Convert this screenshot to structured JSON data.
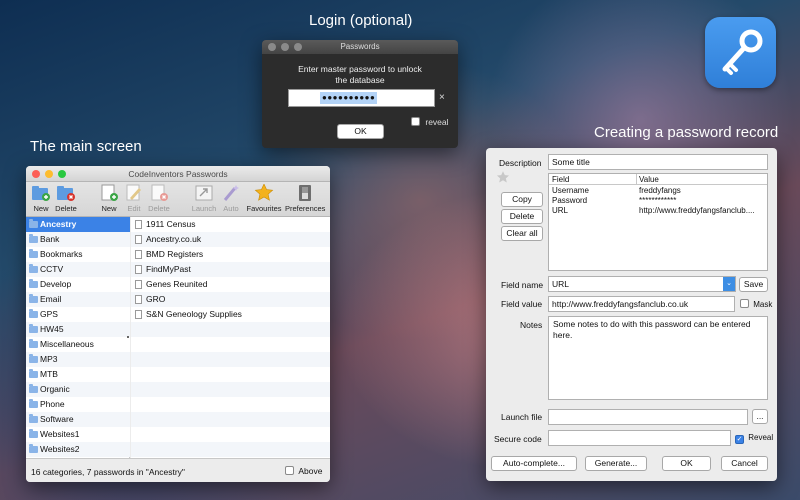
{
  "captions": {
    "login": "Login (optional)",
    "main": "The main screen",
    "record": "Creating a password record"
  },
  "login_dialog": {
    "title": "Passwords",
    "prompt_line1": "Enter master password to unlock",
    "prompt_line2": "the database",
    "password_value": "●●●●●●●●●●",
    "clear_glyph": "×",
    "reveal_label": "reveal",
    "ok_label": "OK"
  },
  "main_window": {
    "title": "CodeInventors Passwords",
    "toolbar": [
      {
        "label": "New",
        "icon": "folder-add-icon",
        "enabled": true
      },
      {
        "label": "Delete",
        "icon": "folder-delete-icon",
        "enabled": true
      },
      {
        "label": "New",
        "icon": "doc-add-icon",
        "enabled": true
      },
      {
        "label": "Edit",
        "icon": "doc-edit-icon",
        "enabled": false
      },
      {
        "label": "Delete",
        "icon": "doc-delete-icon",
        "enabled": false
      },
      {
        "label": "Launch",
        "icon": "launch-icon",
        "enabled": false
      },
      {
        "label": "Auto",
        "icon": "wand-icon",
        "enabled": false
      },
      {
        "label": "Favourites",
        "icon": "star-icon",
        "enabled": true
      },
      {
        "label": "Preferences",
        "icon": "switch-icon",
        "enabled": true
      }
    ],
    "categories": [
      "Ancestry",
      "Bank",
      "Bookmarks",
      "CCTV",
      "Develop",
      "Email",
      "GPS",
      "HW45",
      "Miscellaneous",
      "MP3",
      "MTB",
      "Organic",
      "Phone",
      "Software",
      "Websites1",
      "Websites2"
    ],
    "selected_category": "Ancestry",
    "passwords": [
      "1911 Census",
      "Ancestry.co.uk",
      "BMD Registers",
      "FindMyPast",
      "Genes Reunited",
      "GRO",
      "S&N Geneology Supplies"
    ],
    "status": "16 categories, 7 passwords in \"Ancestry\"",
    "above_label": "Above"
  },
  "record_window": {
    "description_label": "Description",
    "description_value": "Some title",
    "table_headers": [
      "Field",
      "Value"
    ],
    "table_rows": [
      [
        "Username",
        "freddyfangs"
      ],
      [
        "Password",
        "************"
      ],
      [
        "URL",
        "http://www.freddyfangsfanclub...."
      ]
    ],
    "copy_label": "Copy",
    "delete_label": "Delete",
    "clear_all_label": "Clear all",
    "field_name_label": "Field name",
    "field_name_value": "URL",
    "save_label": "Save",
    "field_value_label": "Field value",
    "field_value_value": "http://www.freddyfangsfanclub.co.uk",
    "mask_label": "Mask",
    "notes_label": "Notes",
    "notes_value": "Some notes to do with this password can be entered here.",
    "launch_file_label": "Launch file",
    "browse_label": "...",
    "secure_code_label": "Secure code",
    "reveal_label": "Reveal",
    "reveal_checked": true,
    "autocomplete_label": "Auto-complete...",
    "generate_label": "Generate...",
    "ok_label": "OK",
    "cancel_label": "Cancel"
  },
  "colors": {
    "selection": "#3b82e6",
    "accent_icon_bg": "#3d8ee4"
  }
}
